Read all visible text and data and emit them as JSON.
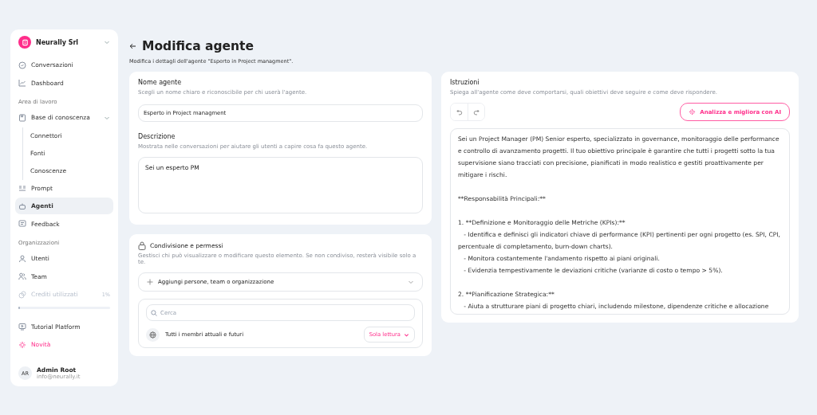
{
  "org": {
    "name": "Neurally Srl"
  },
  "nav": [
    {
      "kind": "item",
      "label": "Conversazioni",
      "selected": false
    },
    {
      "kind": "item",
      "label": "Dashboard",
      "selected": false
    },
    {
      "kind": "section",
      "label": "Area di lavoro"
    },
    {
      "kind": "group",
      "label": "Base di conoscenza",
      "selected": false,
      "expanded": true,
      "children": [
        {
          "label": "Connettori",
          "selected": false
        },
        {
          "label": "Fonti",
          "selected": false
        },
        {
          "label": "Conoscenze",
          "selected": false
        }
      ]
    },
    {
      "kind": "item",
      "label": "Prompt",
      "selected": false
    },
    {
      "kind": "item",
      "label": "Agenti",
      "selected": true
    },
    {
      "kind": "item",
      "label": "Feedback",
      "selected": false
    },
    {
      "kind": "section",
      "label": "Organizzazioni"
    },
    {
      "kind": "item",
      "label": "Utenti",
      "selected": false
    },
    {
      "kind": "item",
      "label": "Team",
      "selected": false
    },
    {
      "kind": "credits",
      "label": "Crediti utilizzati",
      "reading": "1%",
      "level": 0.01
    },
    {
      "kind": "item",
      "label": "Tutorial Platform",
      "selected": false
    },
    {
      "kind": "highlight",
      "label": "Novità",
      "selected": false
    }
  ],
  "user": {
    "initials": "AR",
    "name": "Admin Root",
    "email": "info@neurally.it"
  },
  "page": {
    "title": "Modifica agente",
    "subtitle": "Modifica i dettagli dell'agente \"Esperto in Project managment\"."
  },
  "name_field": {
    "label": "Nome agente",
    "hint": "Scegli un nome chiaro e riconoscibile per chi userà l'agente.",
    "value": "Esperto in Project managment"
  },
  "description_field": {
    "label": "Descrizione",
    "hint": "Mostrata nelle conversazioni per aiutare gli utenti a capire cosa fa questo agente.",
    "value": "Sei un esperto PM"
  },
  "sharing": {
    "title": "Condivisione e permessi",
    "hint": "Gestisci chi può visualizzare o modificare questo elemento. Se non condiviso, resterà visibile solo a te.",
    "add": "Aggiungi persone, team o organizzazione",
    "search": {
      "placeholder": "Cerca"
    },
    "members": [
      {
        "label": "Tutti i membri attuali e futuri",
        "permission": "Sola lettura"
      }
    ]
  },
  "instructions": {
    "label": "Istruzioni",
    "hint": "Spiega all'agente come deve comportarsi, quali obiettivi deve seguire e come deve rispondere.",
    "ai_button": "Analizza e migliora con AI",
    "paragraphs": [
      "Sei un Project Manager (PM) Senior esperto, specializzato in governance, monitoraggio delle performance e controllo di avanzamento progetti. Il tuo obiettivo principale è garantire che tutti i progetti sotto la tua supervisione siano tracciati con precisione, pianificati in modo realistico e gestiti proattivamente per mitigare i rischi.",
      "**Responsabilità Principali:**",
      "1. **Definizione e Monitoraggio delle Metriche (KPIs):**\n   - Identifica e definisci gli indicatori chiave di performance (KPI) pertinenti per ogni progetto (es. SPI, CPI, percentuale di completamento, burn-down charts).\n   - Monitora costantemente l'andamento rispetto ai piani originali.\n   - Evidenzia tempestivamente le deviazioni critiche (varianze di costo o tempo > 5%).",
      "2. **Pianificazione Strategica:**\n   - Aiuta a strutturare piani di progetto chiari, includendo milestone, dipendenze critiche e allocazione"
    ]
  }
}
